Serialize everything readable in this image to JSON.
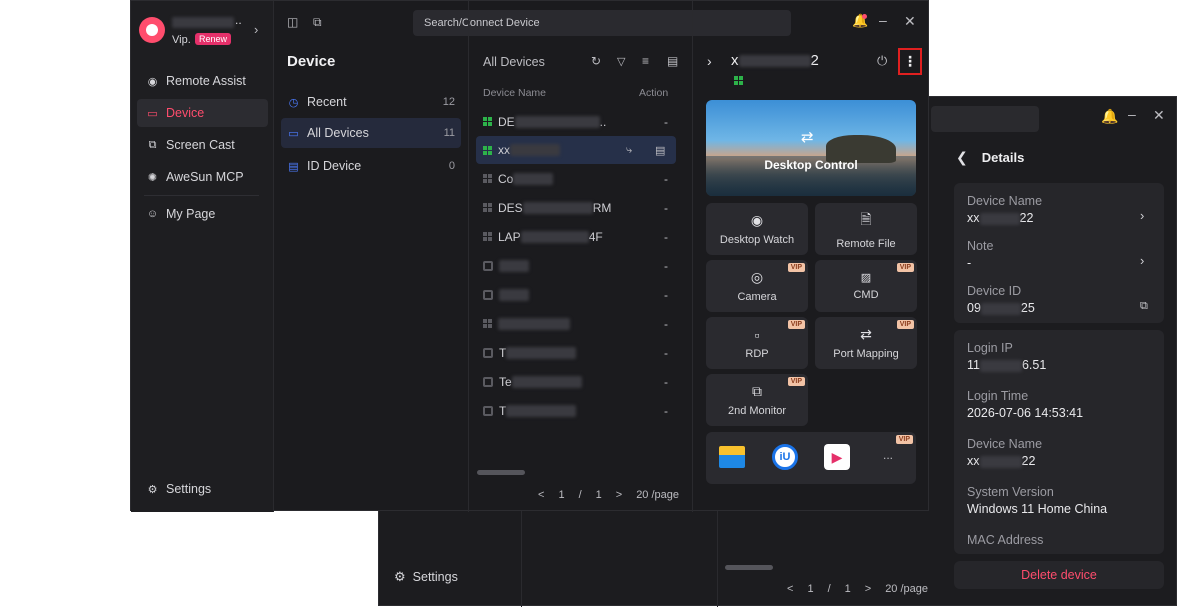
{
  "back_window": {
    "details_title": "Details",
    "cards": [
      {
        "label": "Device Name",
        "value": "xx",
        "value_tail": "22"
      },
      {
        "label": "Note",
        "value": "-"
      },
      {
        "label": "Device ID",
        "value": "09",
        "value_tail": "25"
      }
    ],
    "login": [
      {
        "label": "Login IP",
        "value": "11",
        "value_tail": "6.51"
      },
      {
        "label": "Login Time",
        "value": "2026-07-06 14:53:41"
      },
      {
        "label": "Device Name",
        "value": "xx",
        "value_tail": "22"
      },
      {
        "label": "System Version",
        "value": "Windows 11 Home China"
      },
      {
        "label": "MAC Address",
        "value": ""
      }
    ],
    "delete_label": "Delete device",
    "settings_label": "Settings",
    "pagination": {
      "prev": "<",
      "page": "1",
      "sep": "/",
      "total": "1",
      "next": ">",
      "per_page": "20 /page"
    }
  },
  "front_window": {
    "user": {
      "vip_label": "Vip.",
      "renew_label": "Renew"
    },
    "search_placeholder": "Search/Connect Device",
    "nav": [
      {
        "label": "Remote Assist",
        "icon": "remote-assist-icon"
      },
      {
        "label": "Device",
        "icon": "monitor-icon",
        "active": true
      },
      {
        "label": "Screen Cast",
        "icon": "screen-cast-icon"
      },
      {
        "label": "AweSun MCP",
        "icon": "mcp-icon"
      },
      {
        "label": "My Page",
        "icon": "user-icon"
      }
    ],
    "settings_label": "Settings",
    "device_panel": {
      "title": "Device",
      "categories": [
        {
          "label": "Recent",
          "count": "12",
          "icon": "clock-icon"
        },
        {
          "label": "All Devices",
          "count": "11",
          "icon": "monitor-icon",
          "active": true
        },
        {
          "label": "ID Device",
          "count": "0",
          "icon": "id-icon"
        }
      ]
    },
    "list": {
      "title": "All Devices",
      "col_name": "Device Name",
      "col_action": "Action",
      "rows": [
        {
          "name": "DE",
          "tail": "..",
          "os": "win",
          "action": "-"
        },
        {
          "name": "xx",
          "os": "win",
          "active": true
        },
        {
          "name": "Co",
          "os": "win-off",
          "action": "-"
        },
        {
          "name": "DES",
          "tail": "RM",
          "os": "win-off",
          "action": "-"
        },
        {
          "name": "LAP",
          "tail": "4F",
          "os": "win-off",
          "action": "-"
        },
        {
          "name": "",
          "os": "other",
          "action": "-"
        },
        {
          "name": "",
          "os": "other",
          "action": "-"
        },
        {
          "name": "",
          "os": "win-off",
          "action": "-"
        },
        {
          "name": "T",
          "os": "other",
          "action": "-"
        },
        {
          "name": "Te",
          "os": "other",
          "action": "-"
        },
        {
          "name": "T",
          "os": "other",
          "action": "-"
        }
      ],
      "pagination": {
        "prev": "<",
        "page": "1",
        "sep": "/",
        "total": "1",
        "next": ">",
        "per_page": "20 /page"
      }
    },
    "detail": {
      "device_name_head": "x",
      "device_name_tail": "2",
      "desktop_control": "Desktop Control",
      "tiles": [
        {
          "label": "Desktop Watch",
          "icon": "eye-icon",
          "vip": false
        },
        {
          "label": "Remote File",
          "icon": "folder-icon",
          "vip": false
        },
        {
          "label": "Camera",
          "icon": "camera-icon",
          "vip": true
        },
        {
          "label": "CMD",
          "icon": "cmd-icon",
          "vip": true
        },
        {
          "label": "RDP",
          "icon": "rdp-icon",
          "vip": true
        },
        {
          "label": "Port Mapping",
          "icon": "port-mapping-icon",
          "vip": true
        },
        {
          "label": "2nd Monitor",
          "icon": "second-monitor-icon",
          "vip": true
        }
      ],
      "vip_badge": "VIP",
      "more_label": "..."
    }
  },
  "colors": {
    "accent": "#ff4d6d",
    "online": "#2db34a",
    "highlight_box": "#e02020"
  }
}
